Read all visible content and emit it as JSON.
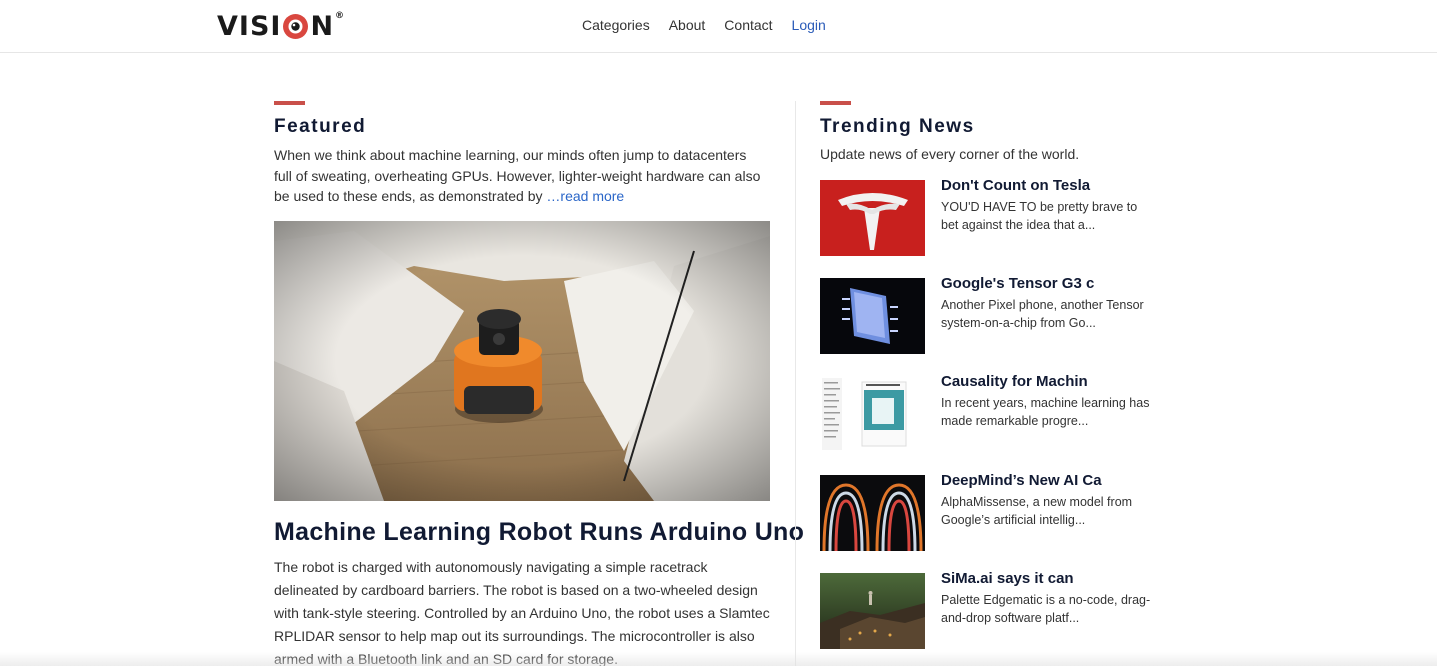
{
  "header": {
    "logo_text_left": "VISI",
    "logo_text_right": "N",
    "logo_reg": "®",
    "nav": [
      "Categories",
      "About",
      "Contact",
      "Login"
    ]
  },
  "featured": {
    "section_title": "Featured",
    "intro": "When we think about machine learning, our minds often jump to datacenters full of sweating, overheating GPUs. However, lighter-weight hardware can also be used to these ends, as demonstrated by",
    "read_more": "…read more",
    "headline": "Machine Learning Robot Runs Arduino Uno",
    "body": "The robot is charged with autonomously navigating a simple racetrack delineated by cardboard barriers. The robot is based on a two-wheeled design with tank-style steering. Controlled by an Arduino Uno, the robot uses a Slamtec RPLIDAR sensor to help map out its surroundings. The microcontroller is also armed with a Bluetooth link and an SD card for storage."
  },
  "trending": {
    "section_title": "Trending News",
    "subtitle": "Update news of every corner of the world.",
    "items": [
      {
        "title": "Don't Count on Tesla",
        "desc": "YOU'D HAVE TO be pretty brave to bet against the idea that a..."
      },
      {
        "title": "Google's Tensor G3 c",
        "desc": "Another Pixel phone, another Tensor system-on-a-chip from Go..."
      },
      {
        "title": "Causality for Machin",
        "desc": "In recent years, machine learning has made remarkable progre..."
      },
      {
        "title": "DeepMind’s New AI Ca",
        "desc": "AlphaMissense, a new model from Google’s artificial intellig..."
      },
      {
        "title": "SiMa.ai says it can",
        "desc": "Palette Edgematic is a no-code, drag-and-drop software platf..."
      }
    ]
  },
  "colors": {
    "accent": "#c9504a",
    "link": "#2a66c8",
    "heading": "#111a33"
  }
}
